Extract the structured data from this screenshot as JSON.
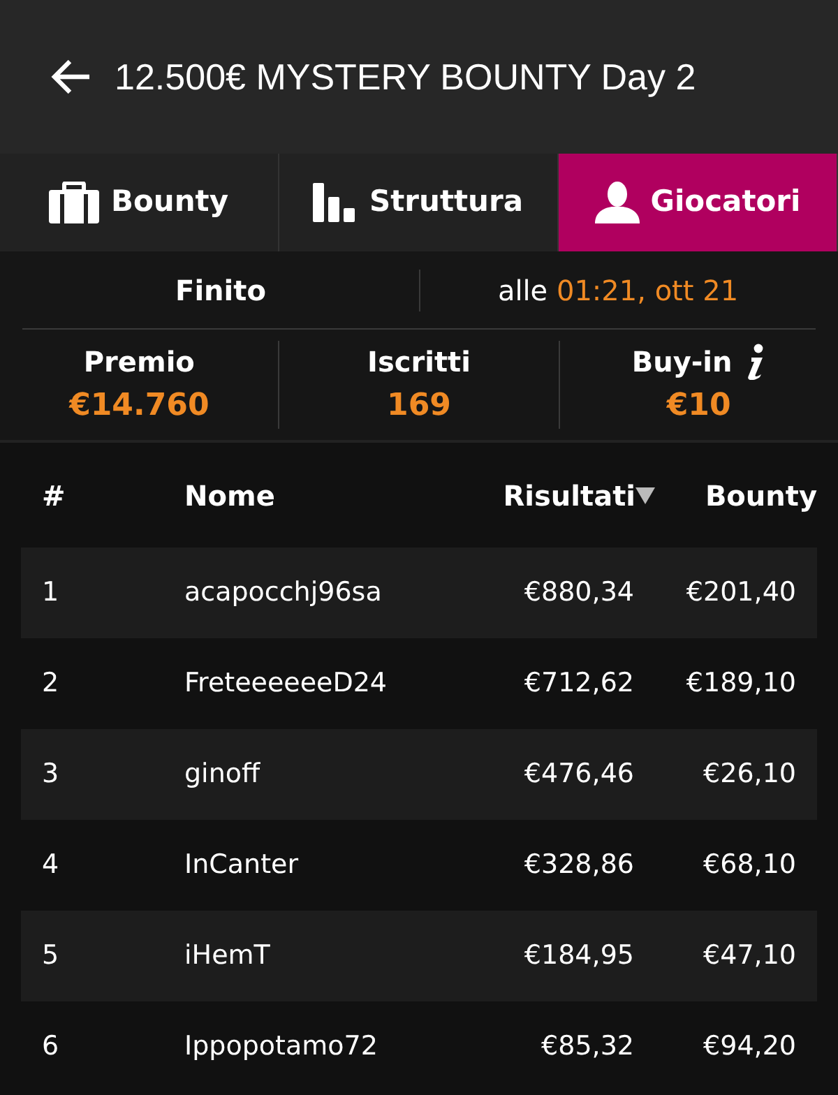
{
  "header": {
    "title": "12.500€ MYSTERY BOUNTY Day 2"
  },
  "tabs": [
    {
      "label": "Bounty",
      "kind": "briefcase",
      "selected": false
    },
    {
      "label": "Struttura",
      "kind": "bars",
      "selected": false
    },
    {
      "label": "Giocatori",
      "kind": "person",
      "selected": true
    }
  ],
  "status": {
    "state": "Finito",
    "prefix": "alle",
    "time": "01:21, ott 21"
  },
  "stats": [
    {
      "label": "Premio",
      "value": "€14.760",
      "info": false
    },
    {
      "label": "Iscritti",
      "value": "169",
      "info": false
    },
    {
      "label": "Buy-in",
      "value": "€10",
      "info": true
    }
  ],
  "table": {
    "columns": [
      {
        "label": "#",
        "sorted": false
      },
      {
        "label": "Nome",
        "sorted": false
      },
      {
        "label": "Risultati",
        "sorted": true
      },
      {
        "label": "Bounty",
        "sorted": false
      }
    ],
    "rows": [
      [
        "1",
        "acapocchj96sa",
        "€880,34",
        "€201,40"
      ],
      [
        "2",
        "FreteeeeeeD24",
        "€712,62",
        "€189,10"
      ],
      [
        "3",
        "ginoff",
        "€476,46",
        "€26,10"
      ],
      [
        "4",
        "InCanter",
        "€328,86",
        "€68,10"
      ],
      [
        "5",
        "iHemT",
        "€184,95",
        "€47,10"
      ],
      [
        "6",
        "Ippopotamo72",
        "€85,32",
        "€94,20"
      ]
    ]
  }
}
